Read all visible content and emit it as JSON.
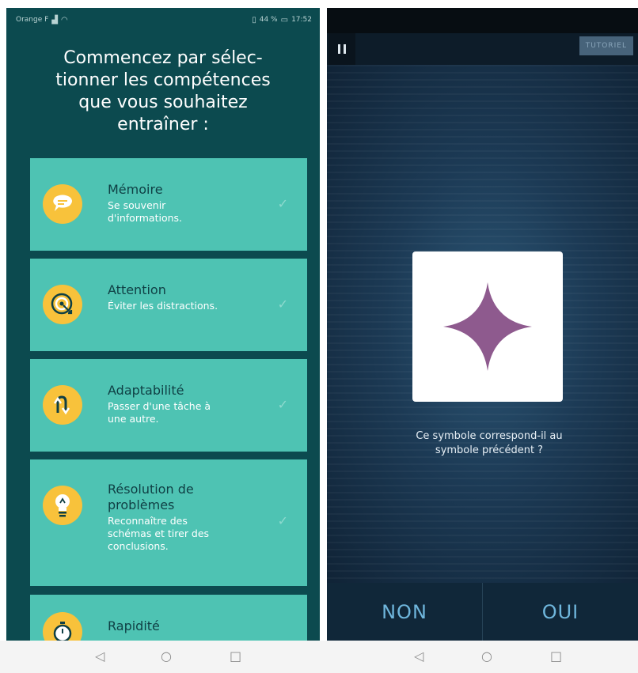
{
  "left_screen": {
    "status_bar": {
      "carrier": "Orange F",
      "battery_text": "44 %",
      "time": "17:52"
    },
    "headline": {
      "line1": "Commencez par sélec-",
      "line2": "tionner les compétences",
      "line3": "que vous souhaitez",
      "line4": "entraîner :"
    },
    "skills": [
      {
        "title": "Mémoire",
        "desc1": "Se souvenir",
        "desc2": "d'informations.",
        "icon": "speech-bubble-icon"
      },
      {
        "title": "Attention",
        "desc1": "Éviter les distractions.",
        "icon": "target-icon"
      },
      {
        "title": "Adaptabilité",
        "desc1": "Passer d'une tâche à",
        "desc2": "une autre.",
        "icon": "switch-arrows-icon"
      },
      {
        "title1": "Résolution de",
        "title2": "problèmes",
        "desc1": "Reconnaître des",
        "desc2": "schémas et tirer des",
        "desc3": "conclusions.",
        "icon": "lightbulb-icon"
      },
      {
        "title": "Rapidité",
        "icon": "stopwatch-icon"
      }
    ],
    "check_glyph": "✓"
  },
  "right_screen": {
    "tutorial_label": "TUTORIEL",
    "question_line1": "Ce symbole correspond-il au",
    "question_line2": "symbole précédent ?",
    "symbol": {
      "shape": "four-point-star",
      "color": "#8e5a8e"
    },
    "no_label": "NON",
    "yes_label": "OUI"
  },
  "nav_glyphs": {
    "back": "◁",
    "home": "○",
    "recent": "□"
  },
  "colors": {
    "left_bg": "#0c4a4f",
    "card_bg": "#4ec3b3",
    "icon_circle": "#f8c23b",
    "right_bg": "#1c3a55",
    "answer_text": "#6fb6dc"
  }
}
